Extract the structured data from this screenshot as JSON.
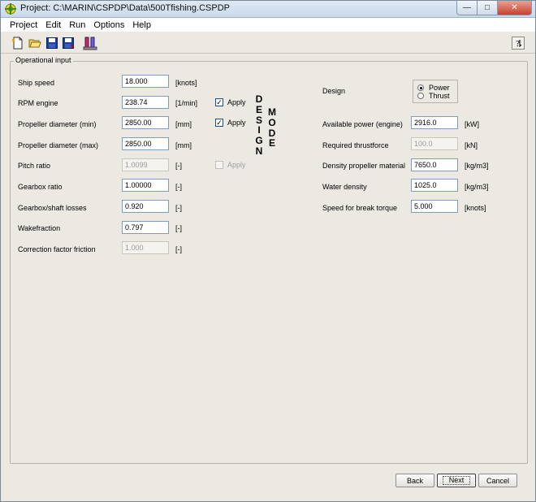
{
  "window": {
    "title": "Project: C:\\MARIN\\CSPDP\\Data\\500Tfishing.CSPDP",
    "minimize_label": "—",
    "maximize_label": "□",
    "close_label": "✕"
  },
  "menu": [
    "Project",
    "Edit",
    "Run",
    "Options",
    "Help"
  ],
  "toolbar": {
    "icons": [
      "new-document-icon",
      "open-folder-icon",
      "save-icon",
      "save-as-icon",
      "pipes-icon"
    ],
    "help_icon": "help-pointer-icon"
  },
  "group": {
    "title": "Operational input"
  },
  "left_fields": [
    {
      "label": "Ship speed",
      "value": "18.000",
      "unit": "[knots]",
      "enabled": true
    },
    {
      "label": "RPM engine",
      "value": "238.74",
      "unit": "[1/min]",
      "enabled": true
    },
    {
      "label": "Propeller diameter (min)",
      "value": "2850.00",
      "unit": "[mm]",
      "enabled": true
    },
    {
      "label": "Propeller diameter (max)",
      "value": "2850.00",
      "unit": "[mm]",
      "enabled": true
    },
    {
      "label": "Pitch ratio",
      "value": "1.0099",
      "unit": "[-]",
      "enabled": false
    },
    {
      "label": "Gearbox ratio",
      "value": "1.00000",
      "unit": "[-]",
      "enabled": true
    },
    {
      "label": "Gearbox/shaft losses",
      "value": "0.920",
      "unit": "[-]",
      "enabled": true
    },
    {
      "label": "Wakefraction",
      "value": "0.797",
      "unit": "[-]",
      "enabled": true
    },
    {
      "label": "Correction factor friction",
      "value": "1.000",
      "unit": "[-]",
      "enabled": false
    }
  ],
  "apply_checks": [
    {
      "label": "Apply",
      "checked": true,
      "enabled": true
    },
    {
      "label": "Apply",
      "checked": true,
      "enabled": true
    },
    {
      "label": "Apply",
      "checked": false,
      "enabled": false
    }
  ],
  "design_mode": {
    "word1": [
      "D",
      "E",
      "S",
      "I",
      "G",
      "N"
    ],
    "word2": [
      "M",
      "O",
      "D",
      "E"
    ]
  },
  "design": {
    "label": "Design",
    "options": [
      {
        "label": "Power",
        "selected": true
      },
      {
        "label": "Thrust",
        "selected": false
      }
    ]
  },
  "right_fields": [
    {
      "label": "Available power (engine)",
      "value": "2916.0",
      "unit": "[kW]",
      "enabled": true
    },
    {
      "label": "Required thrustforce",
      "value": "100.0",
      "unit": "[kN]",
      "enabled": false
    },
    {
      "label": "Density propeller material",
      "value": "7650.0",
      "unit": "[kg/m3]",
      "enabled": true
    },
    {
      "label": "Water density",
      "value": "1025.0",
      "unit": "[kg/m3]",
      "enabled": true
    },
    {
      "label": "Speed for break torque",
      "value": "5.000",
      "unit": "[knots]",
      "enabled": true
    }
  ],
  "buttons": {
    "back": "Back",
    "next": "Next",
    "cancel": "Cancel"
  }
}
